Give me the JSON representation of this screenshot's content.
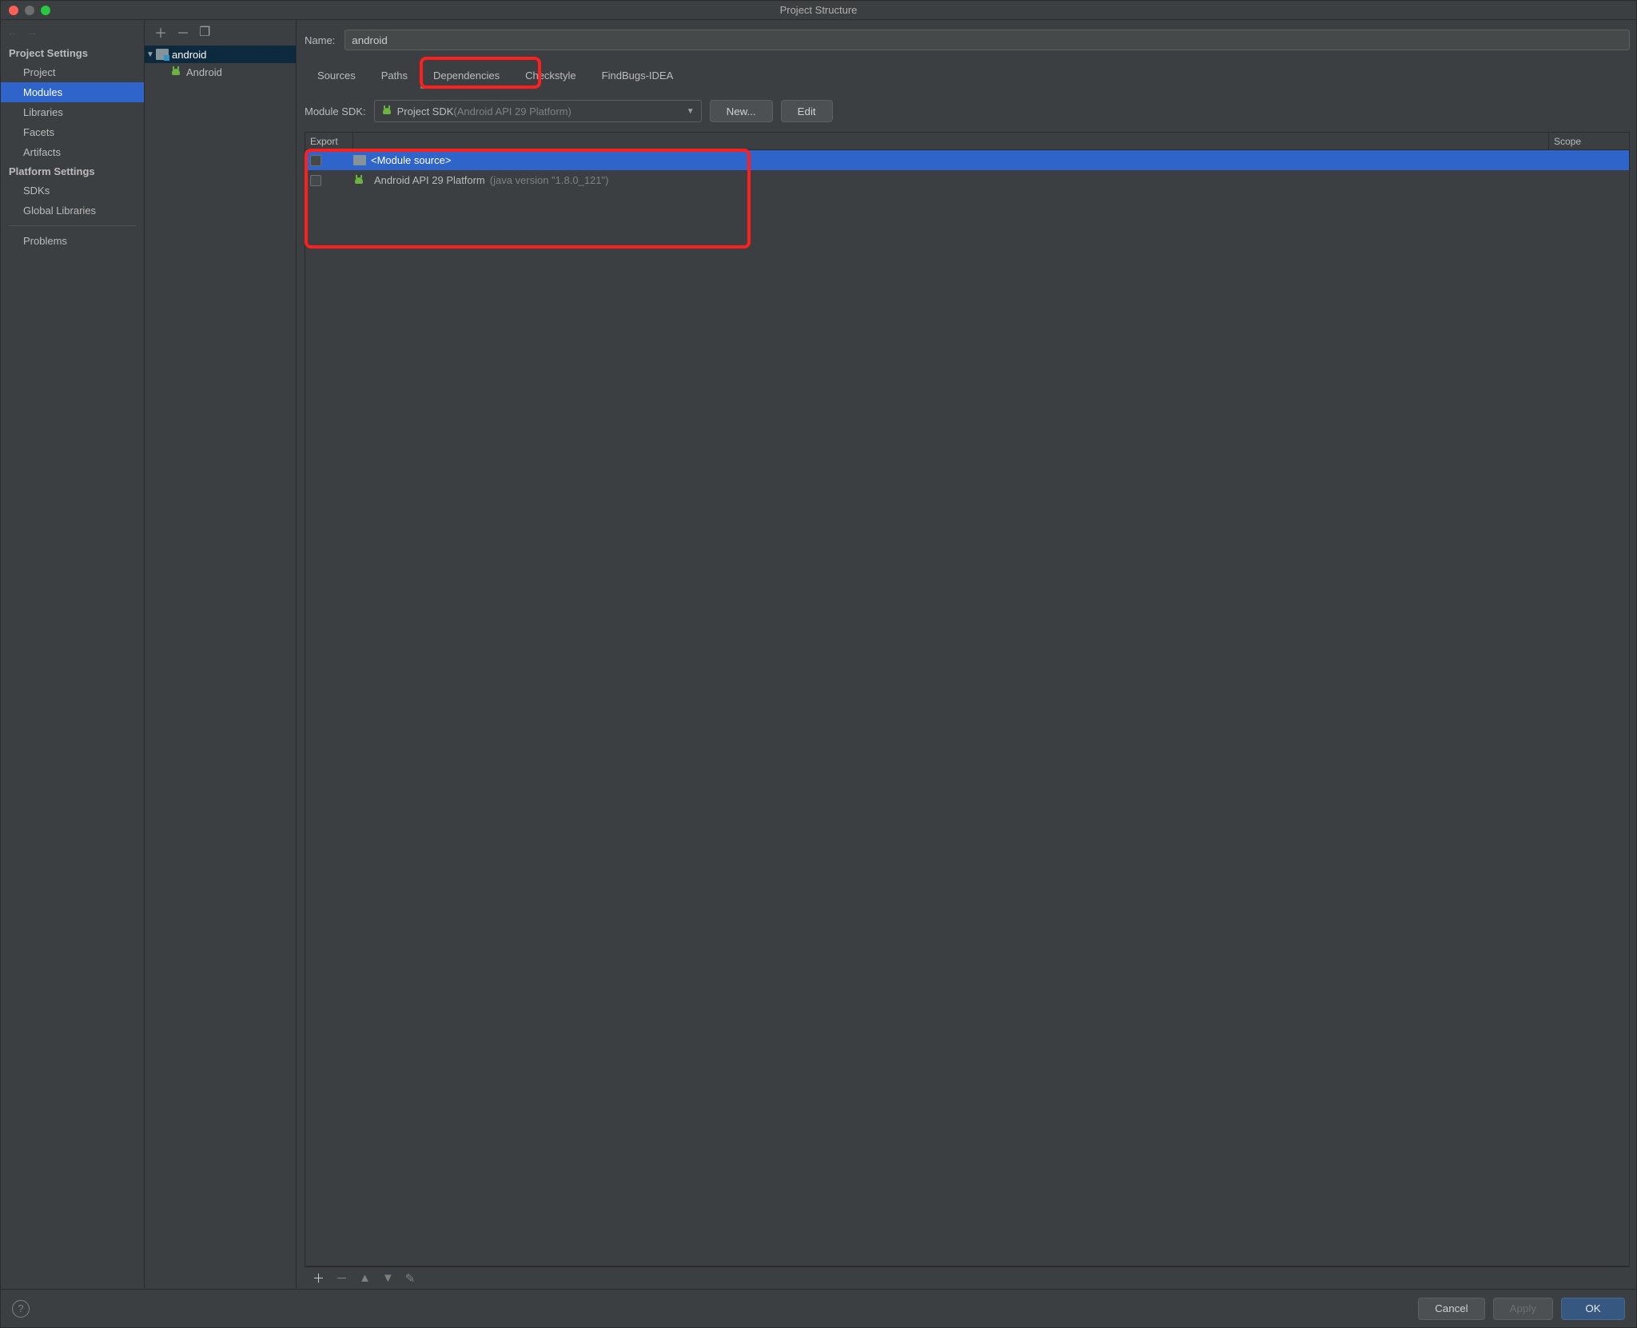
{
  "window": {
    "title": "Project Structure"
  },
  "sidebar": {
    "section1": "Project Settings",
    "items1": [
      "Project",
      "Modules",
      "Libraries",
      "Facets",
      "Artifacts"
    ],
    "section2": "Platform Settings",
    "items2": [
      "SDKs",
      "Global Libraries"
    ],
    "section3_items": [
      "Problems"
    ]
  },
  "tree": {
    "root_label": "android",
    "child_label": "Android"
  },
  "content": {
    "name_label": "Name:",
    "name_value": "android",
    "tabs": [
      "Sources",
      "Paths",
      "Dependencies",
      "Checkstyle",
      "FindBugs-IDEA"
    ],
    "active_tab": 2,
    "sdk_label": "Module SDK:",
    "sdk_value": "Project SDK ",
    "sdk_value_dim": "(Android API 29 Platform)",
    "new_btn": "New...",
    "edit_btn": "Edit",
    "col_export": "Export",
    "col_scope": "Scope",
    "deps": [
      {
        "label": "<Module source>",
        "dim": "",
        "icon": "folder",
        "checkbox": true,
        "selected": true
      },
      {
        "label": "Android API 29 Platform ",
        "dim": "(java version \"1.8.0_121\")",
        "icon": "android",
        "checkbox": true,
        "selected": false
      }
    ]
  },
  "footer": {
    "cancel": "Cancel",
    "apply": "Apply",
    "ok": "OK"
  }
}
